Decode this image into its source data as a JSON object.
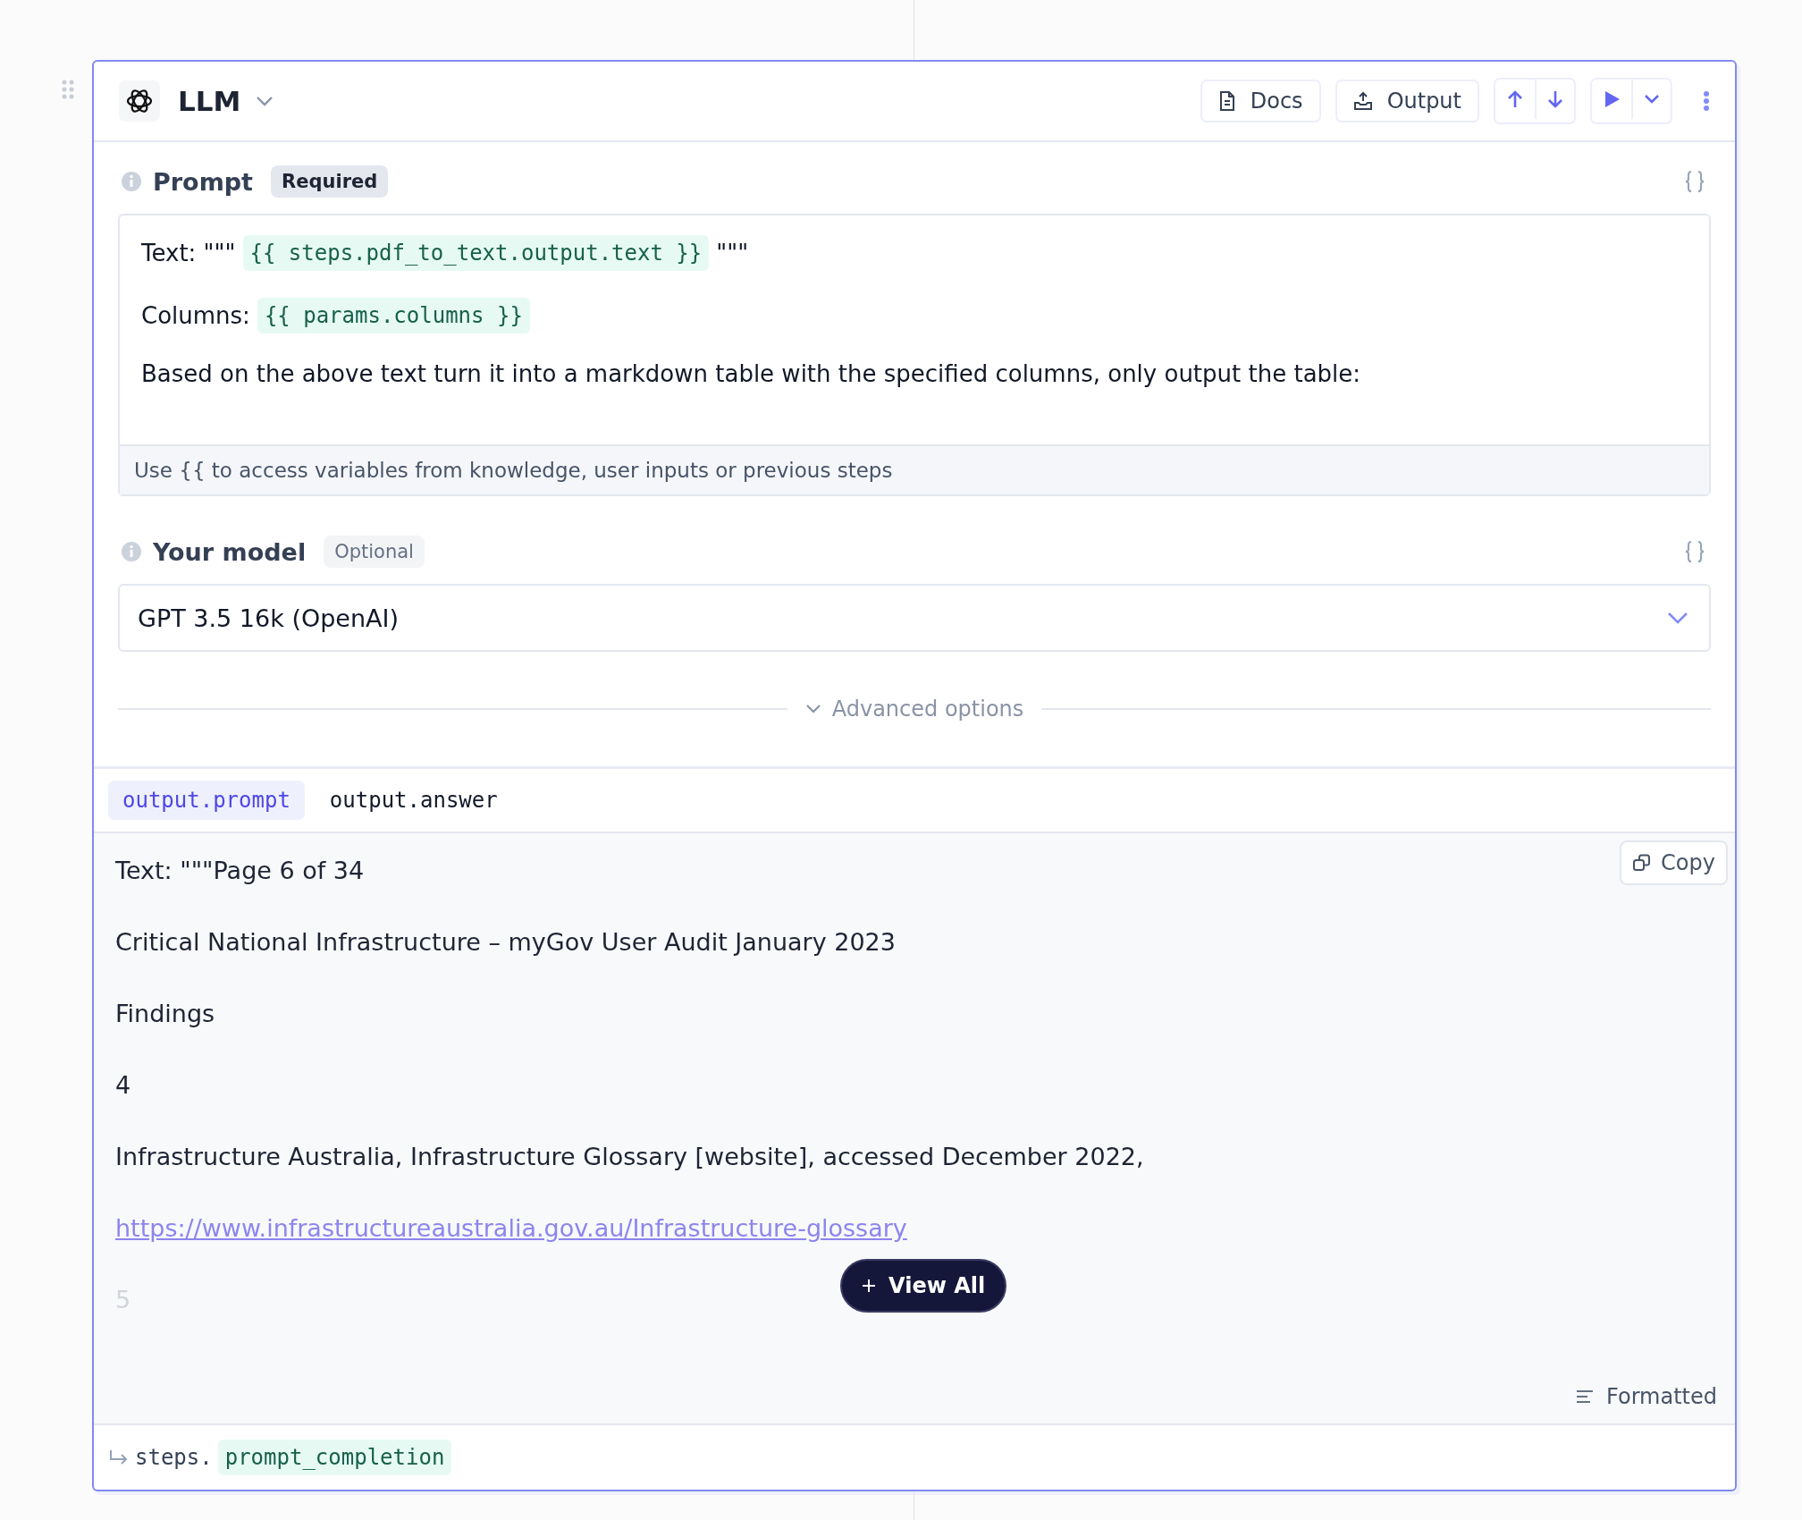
{
  "node": {
    "title": "LLM",
    "buttons": [
      {
        "kind": "docs",
        "label": "Docs"
      },
      {
        "kind": "output",
        "label": "Output"
      }
    ]
  },
  "prompt": {
    "label": "Prompt",
    "badge": "Required",
    "lines": [
      [
        {
          "kind": "text",
          "text": "Text: \"\"\""
        },
        {
          "kind": "var",
          "text": "{{ steps.pdf_to_text.output.text }}"
        },
        {
          "kind": "text",
          "text": "\"\"\""
        }
      ],
      [
        {
          "kind": "text",
          "text": "Columns:"
        },
        {
          "kind": "var",
          "text": "{{ params.columns }}"
        }
      ],
      [
        {
          "kind": "text",
          "text": "Based on the above text turn it into a markdown table with the specified columns, only output the table:"
        }
      ]
    ],
    "hint": "Use {{ to access variables from knowledge, user inputs or previous steps"
  },
  "model": {
    "label": "Your model",
    "badge": "Optional",
    "value": "GPT 3.5 16k (OpenAI)"
  },
  "advanced": "Advanced options",
  "output": {
    "tabs": [
      {
        "label": "output.prompt",
        "selected": true
      },
      {
        "label": "output.answer",
        "selected": false
      }
    ],
    "copy": "Copy",
    "paragraphs": [
      {
        "kind": "text",
        "text": "Text: \"\"\"Page 6 of 34"
      },
      {
        "kind": "text",
        "text": "Critical National Infrastructure – myGov User Audit January 2023"
      },
      {
        "kind": "text",
        "text": "Findings"
      },
      {
        "kind": "text",
        "text": "4"
      },
      {
        "kind": "text",
        "text": "Infrastructure Australia, Infrastructure Glossary [website], accessed December 2022,"
      },
      {
        "kind": "link",
        "text": "https://www.infrastructureaustralia.gov.au/Infrastructure-glossary"
      },
      {
        "kind": "faded",
        "text": "5"
      }
    ],
    "view_all": "View All",
    "format": "Formatted"
  },
  "footer": {
    "prefix": "steps.",
    "name": "prompt_completion"
  }
}
